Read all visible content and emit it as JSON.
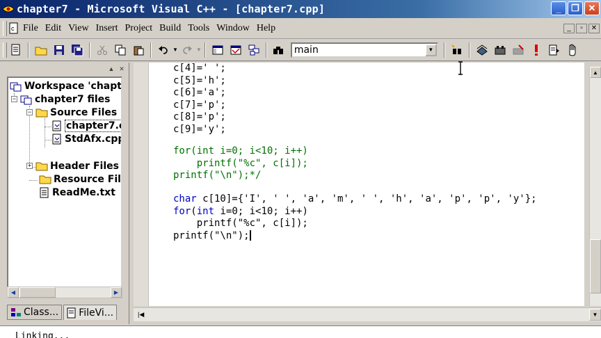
{
  "window": {
    "title": "chapter7 - Microsoft Visual C++ - [chapter7.cpp]"
  },
  "menu": {
    "items": [
      "File",
      "Edit",
      "View",
      "Insert",
      "Project",
      "Build",
      "Tools",
      "Window",
      "Help"
    ]
  },
  "toolbar": {
    "function_combo_value": "main"
  },
  "workspace": {
    "tree": {
      "root": "Workspace 'chapte",
      "project": "chapter7 files",
      "source_folder": "Source Files",
      "source_files": [
        "chapter7.c",
        "StdAfx.cpp"
      ],
      "header_folder": "Header Files",
      "resource_folder": "Resource File",
      "readme": "ReadMe.txt"
    },
    "tabs": [
      "Class...",
      "FileVi..."
    ]
  },
  "editor": {
    "lines": [
      "c[4]=' ';",
      "c[5]='h';",
      "c[6]='a';",
      "c[7]='p';",
      "c[8]='p';",
      "c[9]='y';",
      "",
      "for(int i=0; i<10; i++)",
      "    printf(\"%c\", c[i]);",
      "printf(\"\\n\");*/",
      "",
      "char c[10]={'I', ' ', 'a', 'm', ' ', 'h', 'a', 'p', 'p', 'y'};",
      "for(int i=0; i<10; i++)",
      "    printf(\"%c\", c[i]);",
      "printf(\"\\n\");"
    ]
  },
  "output": {
    "text": "Linking..."
  },
  "colors": {
    "keyword": "#0000c0",
    "comment": "#007000",
    "title_bar": "#0a246a"
  }
}
